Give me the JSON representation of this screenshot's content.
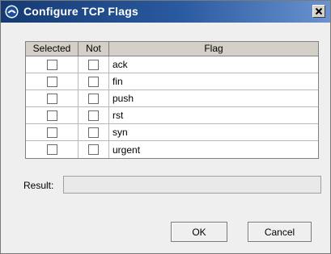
{
  "window": {
    "title": "Configure TCP Flags",
    "icon": "app-logo-icon",
    "close_icon": "close-icon",
    "title_bar_color": "#1f4a8a"
  },
  "table": {
    "columns": [
      "Selected",
      "Not",
      "Flag"
    ],
    "rows": [
      {
        "selected": false,
        "not": false,
        "flag": "ack"
      },
      {
        "selected": false,
        "not": false,
        "flag": "fin"
      },
      {
        "selected": false,
        "not": false,
        "flag": "push"
      },
      {
        "selected": false,
        "not": false,
        "flag": "rst"
      },
      {
        "selected": false,
        "not": false,
        "flag": "syn"
      },
      {
        "selected": false,
        "not": false,
        "flag": "urgent"
      }
    ]
  },
  "result": {
    "label": "Result:",
    "value": ""
  },
  "buttons": {
    "ok_label": "OK",
    "cancel_label": "Cancel"
  }
}
